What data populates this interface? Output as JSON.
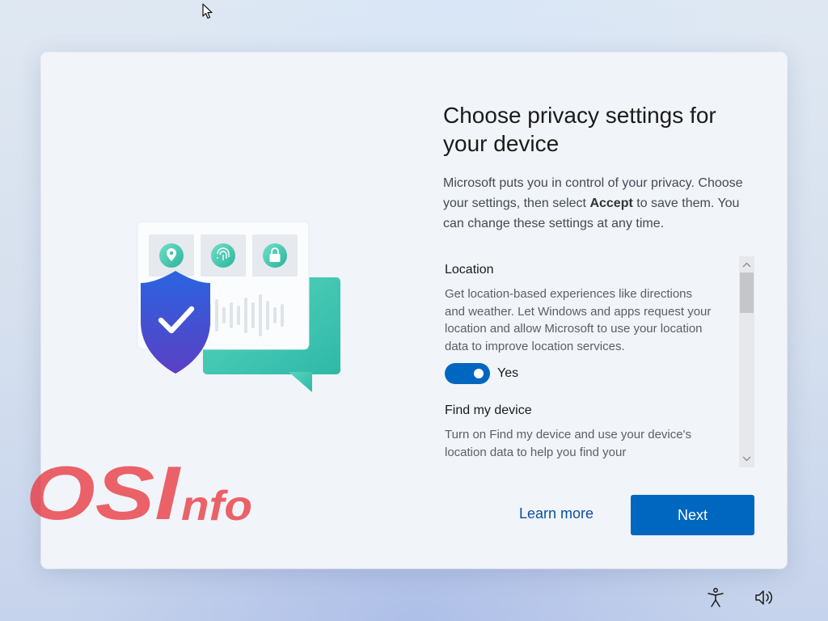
{
  "page": {
    "title": "Choose privacy settings for your device",
    "description_part1": "Microsoft puts you in control of your privacy. Choose your settings, then select ",
    "description_bold": "Accept",
    "description_part2": " to save them. You can change these settings at any time."
  },
  "settings": [
    {
      "title": "Location",
      "description": "Get location-based experiences like directions and weather. Let Windows and apps request your location and allow Microsoft to use your location data to improve location services.",
      "toggle_label": "Yes",
      "enabled": true
    },
    {
      "title": "Find my device",
      "description": "Turn on Find my device and use your device's location data to help you find your"
    }
  ],
  "actions": {
    "learn_more": "Learn more",
    "next": "Next"
  },
  "watermark": {
    "text_large": "OSI",
    "text_small": "nfo",
    "color": "#e8373f"
  },
  "colors": {
    "accent": "#0067c0",
    "link": "#0b4f9c",
    "shield": "#3f60d6",
    "bubble": "#3fc7b0"
  },
  "icons": {
    "cursor": "pointer-cursor-icon",
    "accessibility": "accessibility-icon",
    "volume": "volume-icon"
  }
}
